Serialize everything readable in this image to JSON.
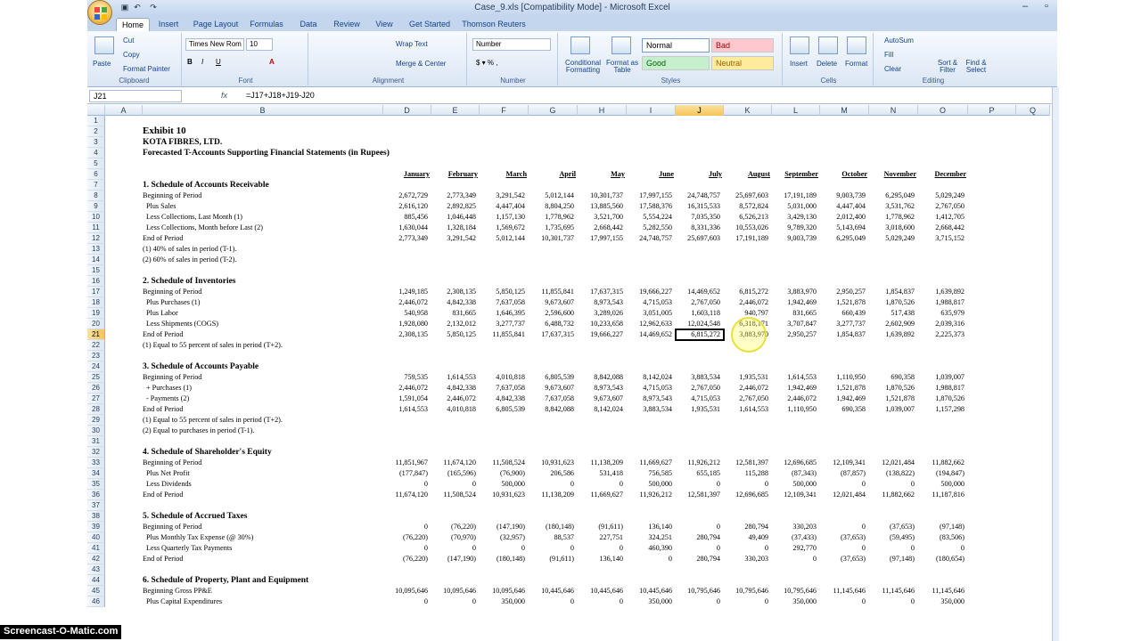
{
  "window": {
    "title": "Case_9.xls  [Compatibility Mode] - Microsoft Excel"
  },
  "tabs": [
    "Home",
    "Insert",
    "Page Layout",
    "Formulas",
    "Data",
    "Review",
    "View",
    "Get Started",
    "Thomson Reuters"
  ],
  "ribbon": {
    "clipboard": {
      "paste": "Paste",
      "cut": "Cut",
      "copy": "Copy",
      "format_painter": "Format Painter",
      "label": "Clipboard"
    },
    "font": {
      "name": "Times New Rom",
      "size": "10",
      "label": "Font"
    },
    "alignment": {
      "wrap": "Wrap Text",
      "merge": "Merge & Center",
      "label": "Alignment"
    },
    "number": {
      "format": "Number",
      "label": "Number"
    },
    "styles": {
      "conditional": "Conditional Formatting",
      "format_table": "Format as Table",
      "normal": "Normal",
      "bad": "Bad",
      "good": "Good",
      "neutral": "Neutral",
      "label": "Styles"
    },
    "cells": {
      "insert": "Insert",
      "delete": "Delete",
      "format": "Format",
      "label": "Cells"
    },
    "editing": {
      "autosum": "AutoSum",
      "fill": "Fill",
      "clear": "Clear",
      "sort": "Sort & Filter",
      "find": "Find & Select",
      "label": "Editing"
    }
  },
  "formula_bar": {
    "name_box": "J21",
    "fx": "fx",
    "formula": "=J17+J18+J19-J20"
  },
  "columns": [
    "A",
    "B",
    "D",
    "E",
    "F",
    "G",
    "H",
    "I",
    "J",
    "K",
    "L",
    "M",
    "N",
    "O",
    "P",
    "Q"
  ],
  "months": [
    "January",
    "February",
    "March",
    "April",
    "May",
    "June",
    "July",
    "August",
    "September",
    "October",
    "November",
    "December"
  ],
  "sheet": [
    {
      "r": "1"
    },
    {
      "r": "2",
      "t": "Exhibit 10",
      "s": "big"
    },
    {
      "r": "3",
      "t": "KOTA FIBRES, LTD.",
      "s": "hd"
    },
    {
      "r": "4",
      "t": "Forecasted T-Accounts Supporting Financial Statements (in Rupees)",
      "s": "hd"
    },
    {
      "r": "5"
    },
    {
      "r": "6",
      "months": true
    },
    {
      "r": "7",
      "t": "1.  Schedule of Accounts Receivable",
      "s": "hd"
    },
    {
      "r": "8",
      "t": "Beginning of Period",
      "v": [
        "2,672,729",
        "2,773,349",
        "3,291,542",
        "5,012,144",
        "10,301,737",
        "17,997,155",
        "24,748,757",
        "25,697,603",
        "17,191,189",
        "9,003,739",
        "6,295,049",
        "5,029,249"
      ]
    },
    {
      "r": "9",
      "t": "Plus Sales",
      "s": "ind",
      "v": [
        "2,616,120",
        "2,892,825",
        "4,447,404",
        "8,804,250",
        "13,885,560",
        "17,588,376",
        "16,315,533",
        "8,572,824",
        "5,031,000",
        "4,447,404",
        "3,531,762",
        "2,767,050"
      ]
    },
    {
      "r": "10",
      "t": "Less Collections, Last Month (1)",
      "s": "ind",
      "v": [
        "885,456",
        "1,046,448",
        "1,157,130",
        "1,778,962",
        "3,521,700",
        "5,554,224",
        "7,035,350",
        "6,526,213",
        "3,429,130",
        "2,012,400",
        "1,778,962",
        "1,412,705"
      ]
    },
    {
      "r": "11",
      "t": "Less Collections, Month before Last (2)",
      "s": "ind",
      "v": [
        "1,630,044",
        "1,328,184",
        "1,569,672",
        "1,735,695",
        "2,668,442",
        "5,282,550",
        "8,331,336",
        "10,553,026",
        "9,789,320",
        "5,143,694",
        "3,018,600",
        "2,668,442"
      ]
    },
    {
      "r": "12",
      "t": "End of Period",
      "v": [
        "2,773,349",
        "3,291,542",
        "5,012,144",
        "10,301,737",
        "17,997,155",
        "24,748,757",
        "25,697,603",
        "17,191,189",
        "9,003,739",
        "6,295,049",
        "5,029,249",
        "3,715,152"
      ]
    },
    {
      "r": "13",
      "t": "(1)  40% of sales in period (T-1)."
    },
    {
      "r": "14",
      "t": "(2)  60% of sales in period (T-2)."
    },
    {
      "r": "15"
    },
    {
      "r": "16",
      "t": "2.  Schedule of Inventories",
      "s": "hd"
    },
    {
      "r": "17",
      "t": "Beginning of Period",
      "v": [
        "1,249,185",
        "2,308,135",
        "5,850,125",
        "11,855,841",
        "17,637,315",
        "19,666,227",
        "14,469,652",
        "6,815,272",
        "3,883,970",
        "2,950,257",
        "1,854,837",
        "1,639,892"
      ]
    },
    {
      "r": "18",
      "t": "Plus Purchases (1)",
      "s": "ind",
      "v": [
        "2,446,072",
        "4,842,338",
        "7,637,058",
        "9,673,607",
        "8,973,543",
        "4,715,053",
        "2,767,050",
        "2,446,072",
        "1,942,469",
        "1,521,878",
        "1,870,526",
        "1,988,817"
      ]
    },
    {
      "r": "19",
      "t": "Plus Labor",
      "s": "ind",
      "v": [
        "540,958",
        "831,665",
        "1,646,395",
        "2,596,600",
        "3,289,026",
        "3,051,005",
        "1,603,118",
        "940,797",
        "831,665",
        "660,439",
        "517,438",
        "635,979"
      ]
    },
    {
      "r": "20",
      "t": "Less Shipments (COGS)",
      "s": "ind",
      "v": [
        "1,928,080",
        "2,132,012",
        "3,277,737",
        "6,488,732",
        "10,233,658",
        "12,962,633",
        "12,024,548",
        "6,318,171",
        "3,707,847",
        "3,277,737",
        "2,602,909",
        "2,039,316"
      ]
    },
    {
      "r": "21",
      "t": "End of Period",
      "v": [
        "2,308,135",
        "5,850,125",
        "11,855,841",
        "17,637,315",
        "19,666,227",
        "14,469,652",
        "6,815,272",
        "3,883,970",
        "2,950,257",
        "1,854,837",
        "1,639,892",
        "2,225,373"
      ]
    },
    {
      "r": "22",
      "t": "(1)  Equal to 55 percent of sales in period (T+2)."
    },
    {
      "r": "23"
    },
    {
      "r": "24",
      "t": "3.  Schedule of Accounts Payable",
      "s": "hd"
    },
    {
      "r": "25",
      "t": "Beginning of Period",
      "v": [
        "759,535",
        "1,614,553",
        "4,010,818",
        "6,805,539",
        "8,842,088",
        "8,142,024",
        "3,883,534",
        "1,935,531",
        "1,614,553",
        "1,110,950",
        "690,358",
        "1,039,007"
      ]
    },
    {
      "r": "26",
      "t": "+ Purchases (1)",
      "s": "ind",
      "v": [
        "2,446,072",
        "4,842,338",
        "7,637,058",
        "9,673,607",
        "8,973,543",
        "4,715,053",
        "2,767,050",
        "2,446,072",
        "1,942,469",
        "1,521,878",
        "1,870,526",
        "1,988,817"
      ]
    },
    {
      "r": "27",
      "t": "- Payments (2)",
      "s": "ind",
      "v": [
        "1,591,054",
        "2,446,072",
        "4,842,338",
        "7,637,058",
        "9,673,607",
        "8,973,543",
        "4,715,053",
        "2,767,050",
        "2,446,072",
        "1,942,469",
        "1,521,878",
        "1,870,526"
      ]
    },
    {
      "r": "28",
      "t": "End of Period",
      "v": [
        "1,614,553",
        "4,010,818",
        "6,805,539",
        "8,842,088",
        "8,142,024",
        "3,883,534",
        "1,935,531",
        "1,614,553",
        "1,110,950",
        "690,358",
        "1,039,007",
        "1,157,298"
      ]
    },
    {
      "r": "29",
      "t": "(1) Equal to 55 percent of sales in period (T+2)."
    },
    {
      "r": "30",
      "t": "(2) Equal to purchases in period (T-1)."
    },
    {
      "r": "31"
    },
    {
      "r": "32",
      "t": "4.  Schedule of Shareholder's Equity",
      "s": "hd"
    },
    {
      "r": "33",
      "t": "Beginning of Period",
      "v": [
        "11,851,967",
        "11,674,120",
        "11,508,524",
        "10,931,623",
        "11,138,209",
        "11,669,627",
        "11,926,212",
        "12,581,397",
        "12,696,685",
        "12,109,341",
        "12,021,484",
        "11,882,662"
      ]
    },
    {
      "r": "34",
      "t": "Plus Net Profit",
      "s": "ind",
      "v": [
        "(177,847)",
        "(165,596)",
        "(76,900)",
        "206,586",
        "531,418",
        "756,585",
        "655,185",
        "115,288",
        "(87,343)",
        "(87,857)",
        "(138,822)",
        "(194,847)"
      ]
    },
    {
      "r": "35",
      "t": "Less Dividends",
      "s": "ind",
      "v": [
        "0",
        "0",
        "500,000",
        "0",
        "0",
        "500,000",
        "0",
        "0",
        "500,000",
        "0",
        "0",
        "500,000"
      ]
    },
    {
      "r": "36",
      "t": "End of Period",
      "v": [
        "11,674,120",
        "11,508,524",
        "10,931,623",
        "11,138,209",
        "11,669,627",
        "11,926,212",
        "12,581,397",
        "12,696,685",
        "12,109,341",
        "12,021,484",
        "11,882,662",
        "11,187,816"
      ]
    },
    {
      "r": "37"
    },
    {
      "r": "38",
      "t": "5.  Schedule of Accrued Taxes",
      "s": "hd"
    },
    {
      "r": "39",
      "t": "Beginning of Period",
      "v": [
        "0",
        "(76,220)",
        "(147,190)",
        "(180,148)",
        "(91,611)",
        "136,140",
        "0",
        "280,794",
        "330,203",
        "0",
        "(37,653)",
        "(97,148)"
      ]
    },
    {
      "r": "40",
      "t": "Plus Monthly Tax Expense (@ 30%)",
      "s": "ind",
      "v": [
        "(76,220)",
        "(70,970)",
        "(32,957)",
        "88,537",
        "227,751",
        "324,251",
        "280,794",
        "49,409",
        "(37,433)",
        "(37,653)",
        "(59,495)",
        "(83,506)"
      ]
    },
    {
      "r": "41",
      "t": "Less Quarterly Tax Payments",
      "s": "ind",
      "v": [
        "0",
        "0",
        "0",
        "0",
        "0",
        "460,390",
        "0",
        "0",
        "292,770",
        "0",
        "0",
        "0"
      ]
    },
    {
      "r": "42",
      "t": "End of Period",
      "v": [
        "(76,220)",
        "(147,190)",
        "(180,148)",
        "(91,611)",
        "136,140",
        "0",
        "280,794",
        "330,203",
        "0",
        "(37,653)",
        "(97,148)",
        "(180,654)"
      ]
    },
    {
      "r": "43"
    },
    {
      "r": "44",
      "t": "6.  Schedule of Property, Plant and Equipment",
      "s": "hd"
    },
    {
      "r": "45",
      "t": "Beginning Gross PP&E",
      "v": [
        "10,095,646",
        "10,095,646",
        "10,095,646",
        "10,445,646",
        "10,445,646",
        "10,445,646",
        "10,795,646",
        "10,795,646",
        "10,795,646",
        "11,145,646",
        "11,145,646",
        "11,145,646"
      ]
    },
    {
      "r": "46",
      "t": "Plus Capital Expenditures",
      "s": "ind",
      "v": [
        "0",
        "0",
        "350,000",
        "0",
        "0",
        "350,000",
        "0",
        "0",
        "350,000",
        "0",
        "0",
        "350,000"
      ]
    }
  ],
  "watermark": "Screencast-O-Matic.com"
}
